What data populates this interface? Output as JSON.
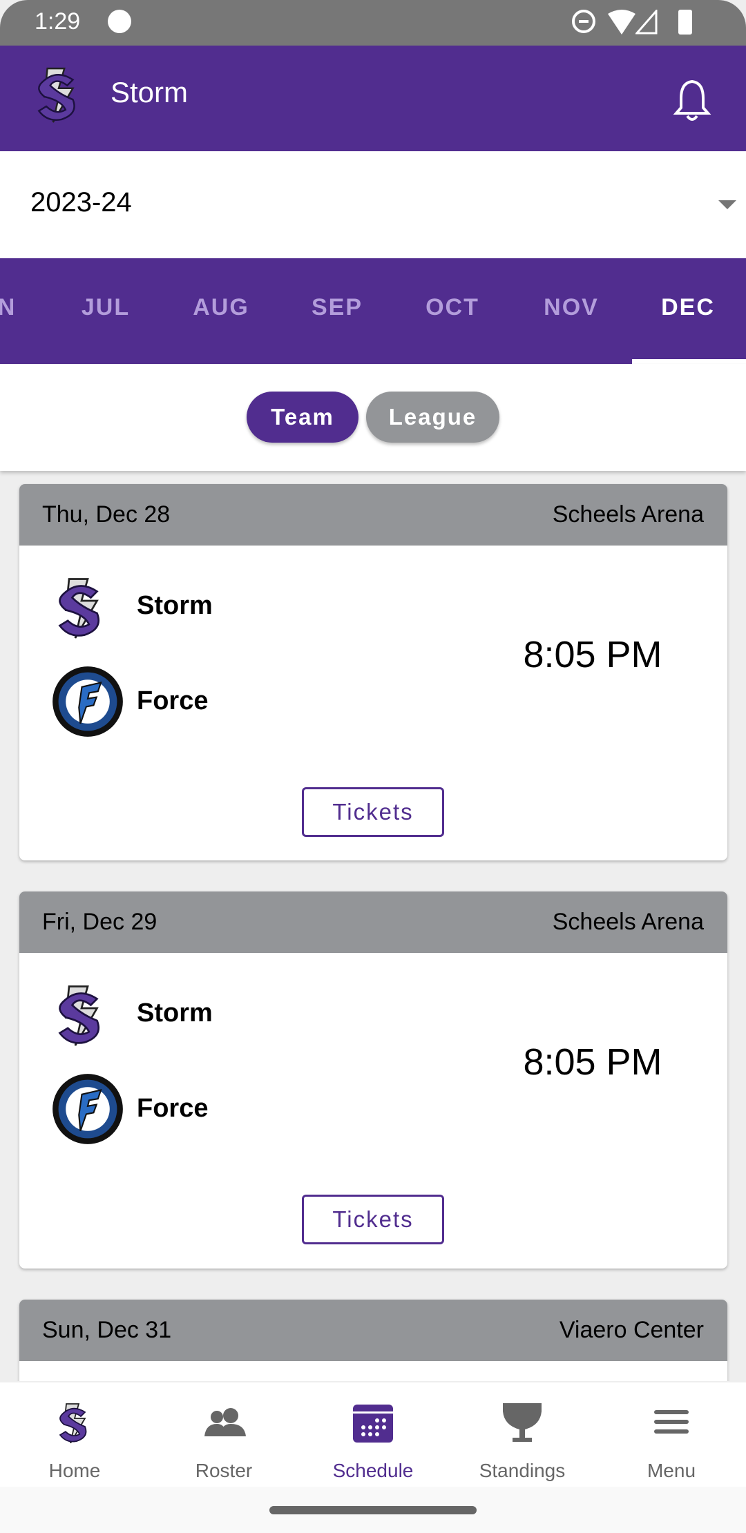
{
  "status_bar": {
    "time": "1:29"
  },
  "app_bar": {
    "title": "Storm",
    "logo": "storm-logo",
    "notification_icon": "bell-icon"
  },
  "season_select": {
    "value": "2023-24"
  },
  "months": {
    "items": [
      "JUN",
      "JUL",
      "AUG",
      "SEP",
      "OCT",
      "NOV",
      "DEC"
    ],
    "visible_partial": "N",
    "active": "DEC"
  },
  "toggle": {
    "team": "Team",
    "league": "League",
    "active": "Team"
  },
  "games": [
    {
      "date": "Thu, Dec 28",
      "venue": "Scheels Arena",
      "home": "Storm",
      "away": "Force",
      "time": "8:05 PM",
      "tickets": "Tickets"
    },
    {
      "date": "Fri, Dec 29",
      "venue": "Scheels Arena",
      "home": "Storm",
      "away": "Force",
      "time": "8:05 PM",
      "tickets": "Tickets"
    },
    {
      "date": "Sun, Dec 31",
      "venue": "Viaero Center"
    }
  ],
  "bottom_nav": [
    {
      "label": "Home",
      "icon": "storm-logo-icon"
    },
    {
      "label": "Roster",
      "icon": "people-icon"
    },
    {
      "label": "Schedule",
      "icon": "calendar-icon",
      "active": true
    },
    {
      "label": "Standings",
      "icon": "trophy-icon"
    },
    {
      "label": "Menu",
      "icon": "menu-icon"
    }
  ],
  "colors": {
    "primary": "#512d8f",
    "header_gray": "#939598",
    "inactive_month": "#b39ddb",
    "league_pill": "#939598"
  }
}
